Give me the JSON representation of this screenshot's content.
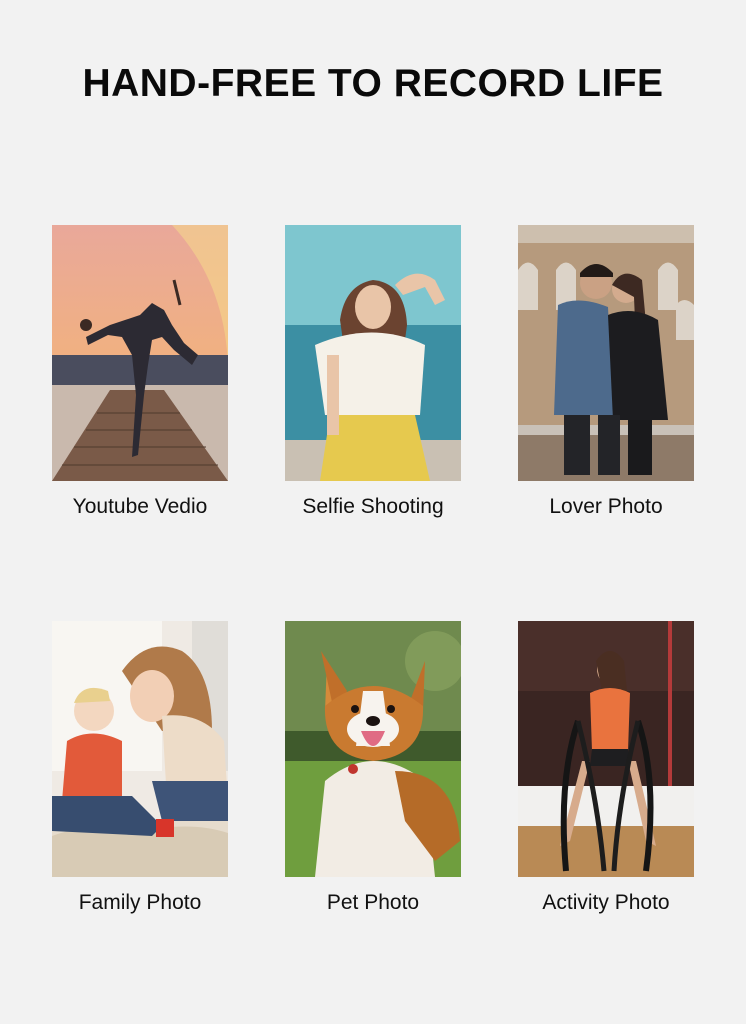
{
  "heading": "HAND-FREE TO RECORD LIFE",
  "cards": [
    {
      "caption": "Youtube Vedio",
      "scene": "dancer-on-pier-sunset"
    },
    {
      "caption": "Selfie Shooting",
      "scene": "woman-selfie-by-sea"
    },
    {
      "caption": "Lover Photo",
      "scene": "couple-at-colosseum"
    },
    {
      "caption": "Family Photo",
      "scene": "mother-and-baby"
    },
    {
      "caption": "Pet Photo",
      "scene": "corgi-on-grass"
    },
    {
      "caption": "Activity Photo",
      "scene": "woman-with-battle-ropes"
    }
  ]
}
